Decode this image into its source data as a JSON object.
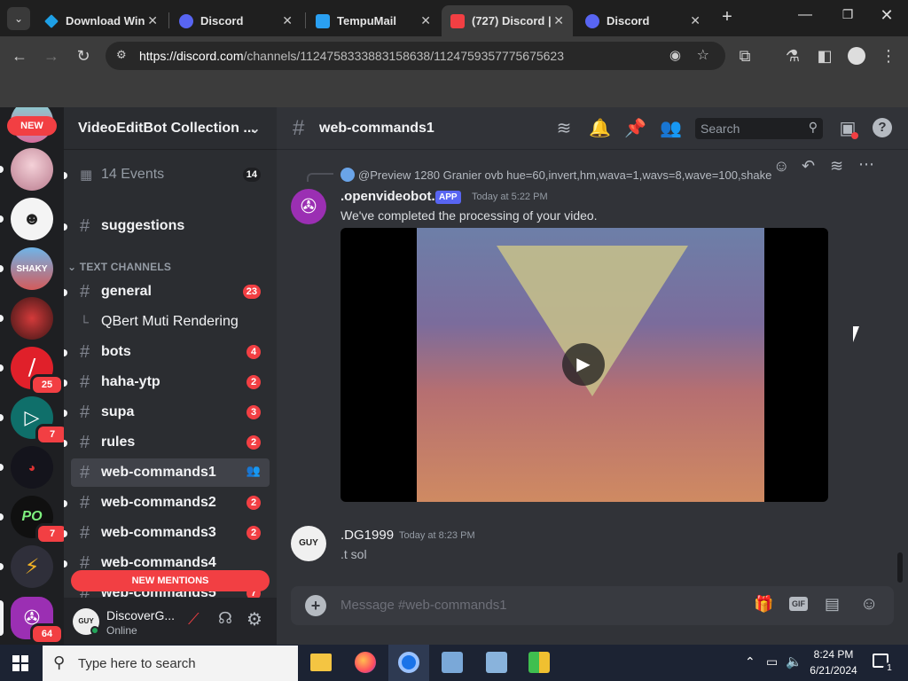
{
  "browser": {
    "tabs": [
      {
        "label": "Download Win"
      },
      {
        "label": "Discord"
      },
      {
        "label": "TempuMail"
      },
      {
        "label": "(727) Discord |"
      },
      {
        "label": "Discord"
      }
    ],
    "url_host": "https://discord.com",
    "url_path": "/channels/1124758333883158638/1124759357775675623"
  },
  "discord": {
    "server_name": "VideoEditBot Collection ...",
    "rail": {
      "new_label": "NEW",
      "badges": [
        "25",
        "7",
        "7",
        "64"
      ]
    },
    "events": {
      "label": "14 Events",
      "count": "14"
    },
    "channels_top": [
      {
        "name": "suggestions"
      }
    ],
    "category_text": "TEXT CHANNELS",
    "channels": [
      {
        "name": "general",
        "badge": "23"
      },
      {
        "name": "bots",
        "badge": "4"
      },
      {
        "name": "haha-ytp",
        "badge": "2"
      },
      {
        "name": "supa",
        "badge": "3"
      },
      {
        "name": "rules",
        "badge": "2"
      },
      {
        "name": "web-commands1",
        "badge": ""
      },
      {
        "name": "web-commands2",
        "badge": "2"
      },
      {
        "name": "web-commands3",
        "badge": "2"
      },
      {
        "name": "web-commands4",
        "badge": ""
      },
      {
        "name": "web-commands5",
        "badge": "7"
      }
    ],
    "thread": {
      "name": "QBert Muti Rendering"
    },
    "new_mentions": "NEW MENTIONS",
    "user": {
      "name": "DiscoverG...",
      "status": "Online"
    },
    "chat": {
      "channel_name": "web-commands1",
      "search_placeholder": "Search",
      "reply_preview": "@Preview 1280 Granier  ovb hue=60,invert,hm,wava=1,wavs=8,wave=100,shake",
      "messages": [
        {
          "author": ".openvideobot.",
          "tag": "APP",
          "time": "Today at 5:22 PM",
          "text": "We've completed the processing of your video."
        },
        {
          "author": ".DG1999",
          "tag": "",
          "time": "Today at 8:23 PM",
          "text": ".t sol"
        }
      ],
      "input_placeholder": "Message #web-commands1"
    }
  },
  "taskbar": {
    "search_placeholder": "Type here to search",
    "time": "8:24 PM",
    "date": "6/21/2024",
    "notif_count": "1"
  },
  "colors": {
    "discord_red": "#f23f43",
    "discord_blurple": "#5865f2",
    "app_tag": "#5865f2"
  }
}
